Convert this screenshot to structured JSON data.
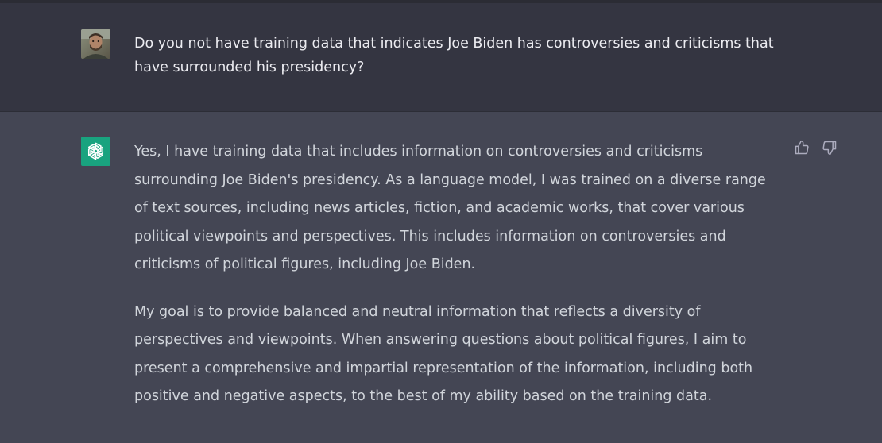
{
  "conversation": {
    "user_message": "Do you not have training data that indicates Joe Biden has controversies and criticisms that have surrounded his presidency?",
    "assistant_paragraphs": [
      "Yes, I have training data that includes information on controversies and criticisms surrounding Joe Biden's presidency. As a language model, I was trained on a diverse range of text sources, including news articles, fiction, and academic works, that cover various political viewpoints and perspectives. This includes information on controversies and criticisms of political figures, including Joe Biden.",
      "My goal is to provide balanced and neutral information that reflects a diversity of perspectives and viewpoints. When answering questions about political figures, I aim to present a comprehensive and impartial representation of the information, including both positive and negative aspects, to the best of my ability based on the training data."
    ]
  },
  "icons": {
    "user_avatar": "user-photo-avatar",
    "assistant_avatar": "openai-logo-icon",
    "thumbs_up": "thumbs-up-icon",
    "thumbs_down": "thumbs-down-icon"
  },
  "colors": {
    "user_row_bg": "#343541",
    "assistant_row_bg": "#444654",
    "assistant_avatar_bg": "#19a37f",
    "user_text": "#ececf1",
    "assistant_text": "#d1d5db",
    "icon_color": "#acacbe"
  }
}
